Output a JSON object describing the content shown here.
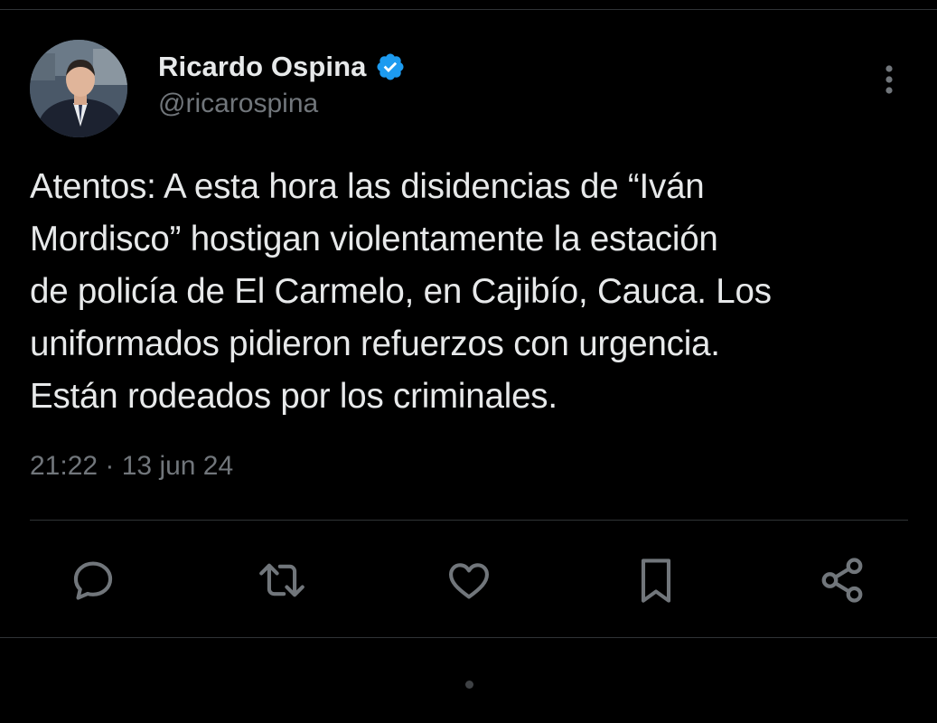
{
  "author": {
    "name": "Ricardo Ospina",
    "handle": "@ricarospina",
    "verified": true,
    "avatar_icon": "profile-photo",
    "verified_color": "#1d9bf0"
  },
  "tweet": {
    "lines": [
      "Atentos: A esta hora las disidencias de “Iván",
      "Mordisco” hostigan violentamente la estación",
      "de policía de El Carmelo, en Cajibío, Cauca. Los",
      "uniformados pidieron refuerzos con urgencia.",
      "Están rodeados por los criminales."
    ],
    "timestamp": "21:22 · 13 jun 24"
  },
  "actions": [
    {
      "name": "reply",
      "icon": "reply-icon"
    },
    {
      "name": "retweet",
      "icon": "retweet-icon"
    },
    {
      "name": "like",
      "icon": "heart-icon"
    },
    {
      "name": "bookmark",
      "icon": "bookmark-icon"
    },
    {
      "name": "share",
      "icon": "share-icon"
    }
  ],
  "theme": {
    "background": "#000000",
    "text_primary": "#e7e9ea",
    "text_secondary": "#71767b",
    "divider": "#2f3336"
  }
}
